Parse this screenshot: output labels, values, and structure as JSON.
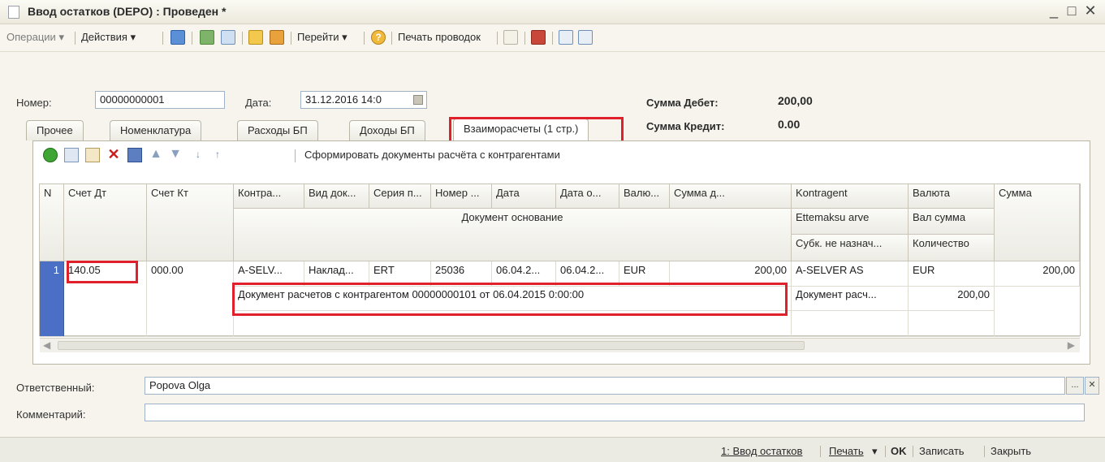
{
  "window": {
    "title": "Ввод остатков (DEPO) : Проведен *",
    "min": "_",
    "max": "□",
    "close": "✕"
  },
  "toolbar": {
    "operations": "Операции",
    "actions": "Действия",
    "goto": "Перейти",
    "help": "?",
    "print_entries": "Печать проводок",
    "dropdown_arrow": "▾"
  },
  "header": {
    "number_label": "Номер:",
    "number_value": "00000000001",
    "date_label": "Дата:",
    "date_value": "31.12.2016 14:0",
    "sum_debit_label": "Сумма Дебет:",
    "sum_debit_value": "200,00",
    "sum_credit_label": "Сумма Кредит:",
    "sum_credit_value": "0.00"
  },
  "tabs": [
    {
      "label": "Прочее"
    },
    {
      "label": "Номенклатура"
    },
    {
      "label": "Расходы БП"
    },
    {
      "label": "Доходы БП"
    },
    {
      "label": "Взаиморасчеты (1 стр.)"
    }
  ],
  "grid_toolbar": {
    "generate_docs": "Сформировать документы расчёта с контрагентами"
  },
  "grid": {
    "columns": {
      "n": "N",
      "account_dt": "Счет Дт",
      "account_kt": "Счет Кт",
      "contra": "Контра...",
      "doc_type": "Вид док...",
      "series": "Серия п...",
      "number": "Номер ...",
      "date": "Дата",
      "date_o": "Дата о...",
      "currency": "Валю...",
      "sum_d": "Сумма д...",
      "kontragent": "Kontragent",
      "valuta": "Валюта",
      "summa": "Сумма",
      "doc_basis": "Документ основание",
      "ettemaksu": "Ettemaksu arve",
      "val_sum": "Вал сумма",
      "subk": "Субк. не назнач...",
      "quantity": "Количество"
    },
    "rows": [
      {
        "n": "1",
        "account_dt": "140.05",
        "account_kt": "000.00",
        "contra": "A-SELV...",
        "doc_type": "Наклад...",
        "series": "ERT",
        "number": "25036",
        "date": "06.04.2...",
        "date_o": "06.04.2...",
        "currency": "EUR",
        "sum_d": "200,00",
        "kontragent": "A-SELVER AS",
        "valuta": "EUR",
        "summa": "200,00",
        "doc_basis": "Документ расчетов с контрагентом 00000000101 от 06.04.2015 0:00:00",
        "ettemaksu": "Документ расч...",
        "val_sum": "200,00"
      }
    ]
  },
  "responsible": {
    "label": "Ответственный:",
    "value": "Popova Olga",
    "select": "...",
    "clear": "✕"
  },
  "comment": {
    "label": "Комментарий:",
    "value": ""
  },
  "footer": {
    "doc_link": "1: Ввод остатков",
    "print": "Печать",
    "ok": "OK",
    "save": "Записать",
    "close": "Закрыть"
  },
  "colors": {
    "highlight": "#e0202a",
    "accent": "#4a6fc4",
    "selected_row": "#4a6fc4"
  }
}
